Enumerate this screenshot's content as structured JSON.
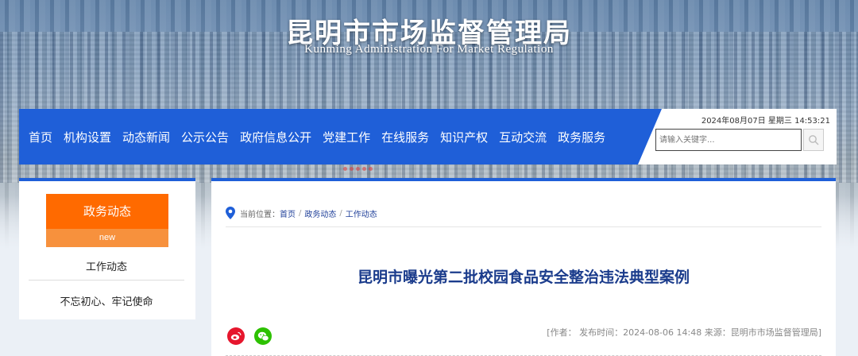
{
  "header": {
    "title": "昆明市市场监督管理局",
    "subtitle": "Kunming Administration For Market Regulation"
  },
  "nav": {
    "items": [
      "首页",
      "机构设置",
      "动态新闻",
      "公示公告",
      "政府信息公开",
      "党建工作",
      "在线服务",
      "知识产权",
      "互动交流",
      "政务服务"
    ],
    "datetime": "2024年08月07日 星期三 14:53:21",
    "search_placeholder": "请输入关键字..."
  },
  "sidebar": {
    "heading": "政务动态",
    "badge": "new",
    "items": [
      "工作动态",
      "不忘初心、牢记使命"
    ]
  },
  "breadcrumb": {
    "prefix": "当前位置：",
    "items": [
      "首页",
      "政务动态",
      "工作动态"
    ],
    "separator": "/"
  },
  "article": {
    "title": "昆明市曝光第二批校园食品安全整治违法典型案例",
    "meta": "[作者：  发布时间：2024-08-06 14:48 来源：昆明市市场监督管理局]"
  },
  "colors": {
    "nav_blue": "#1f5fd8",
    "sidebar_orange": "#ff6a00",
    "title_blue": "#1b3c8c",
    "weibo_red": "#e6162d",
    "wechat_green": "#2dc100"
  }
}
